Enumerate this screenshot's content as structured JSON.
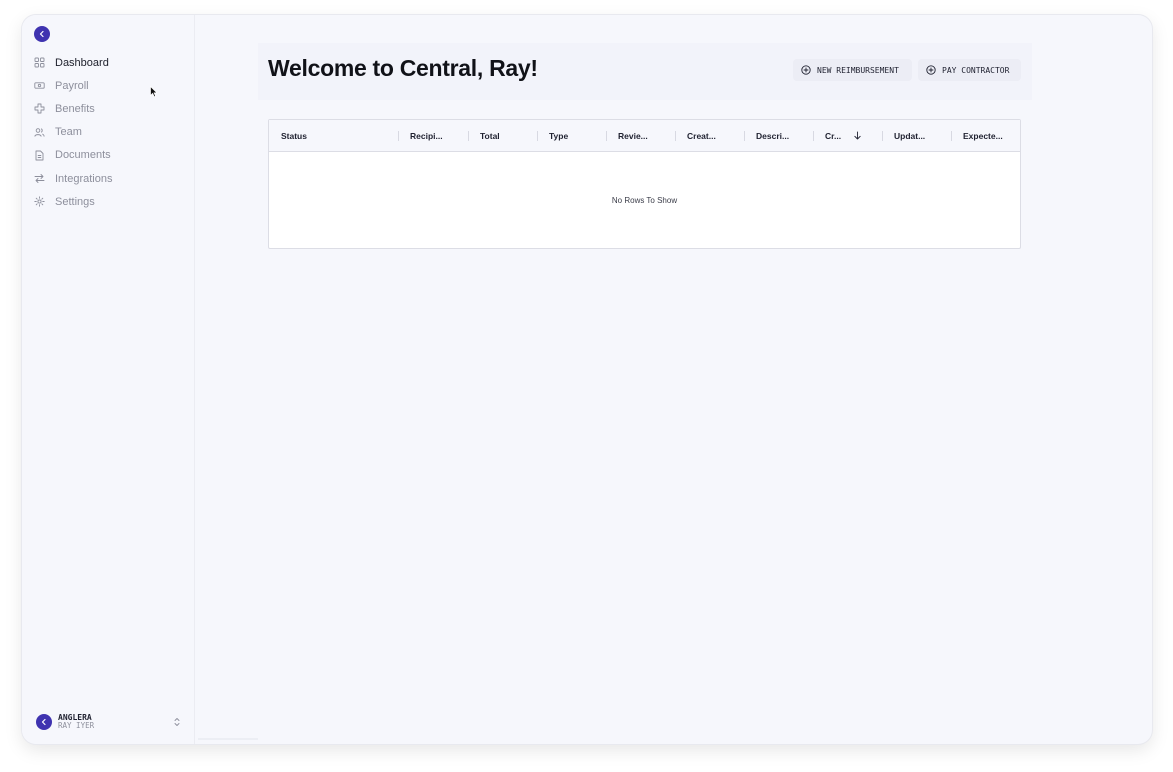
{
  "app": {
    "brand_color": "#3f33b0",
    "logo_icon": "chevron-left-icon"
  },
  "sidebar": {
    "items": [
      {
        "label": "Dashboard",
        "icon": "grid-icon",
        "active": true
      },
      {
        "label": "Payroll",
        "icon": "banknote-icon",
        "active": false
      },
      {
        "label": "Benefits",
        "icon": "plus-cross-icon",
        "active": false
      },
      {
        "label": "Team",
        "icon": "users-icon",
        "active": false
      },
      {
        "label": "Documents",
        "icon": "document-icon",
        "active": false
      },
      {
        "label": "Integrations",
        "icon": "arrows-swap-icon",
        "active": false
      },
      {
        "label": "Settings",
        "icon": "gear-icon",
        "active": false
      }
    ],
    "user": {
      "org": "ANGLERA",
      "name": "RAY IYER"
    }
  },
  "main": {
    "title": "Welcome to Central, Ray!",
    "actions": {
      "new_reimbursement": "NEW REIMBURSEMENT",
      "pay_contractor": "PAY CONTRACTOR"
    },
    "table": {
      "columns": [
        {
          "label": "Status"
        },
        {
          "label": "Recipi..."
        },
        {
          "label": "Total"
        },
        {
          "label": "Type"
        },
        {
          "label": "Revie..."
        },
        {
          "label": "Creat..."
        },
        {
          "label": "Descri..."
        },
        {
          "label": "Cr...",
          "sorted": "descending"
        },
        {
          "label": "Updat..."
        },
        {
          "label": "Expecte..."
        }
      ],
      "empty_message": "No Rows To Show"
    }
  }
}
